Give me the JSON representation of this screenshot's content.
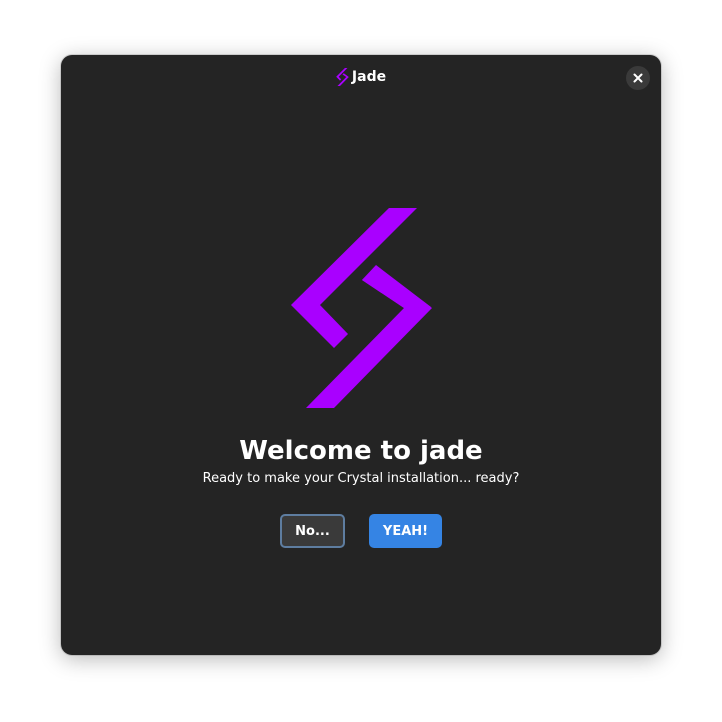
{
  "window": {
    "title": "Jade",
    "close_icon": "close-icon",
    "app_icon": "jade-logo-icon"
  },
  "welcome": {
    "heading": "Welcome to jade",
    "subtitle": "Ready to make your Crystal installation... ready?"
  },
  "actions": {
    "no_label": "No...",
    "yes_label": "YEAH!"
  },
  "colors": {
    "window_bg": "#242424",
    "logo_accent": "#a900ff",
    "primary_button": "#3584e4",
    "secondary_button": "#3a3a3a",
    "focus_ring": "#5e7da0",
    "text": "#ffffff"
  }
}
